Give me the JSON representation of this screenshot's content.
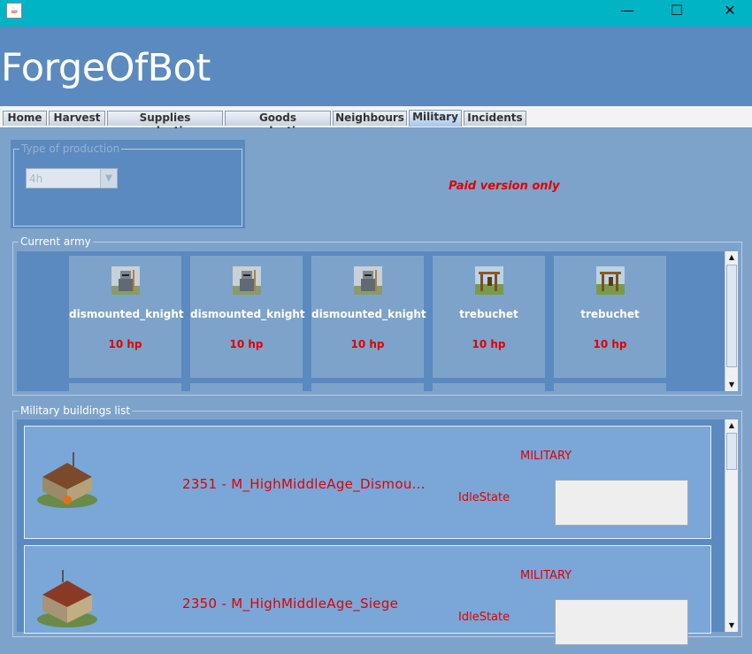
{
  "window": {
    "controls": {
      "minimize": "—",
      "maximize": "☐",
      "close": "✕"
    }
  },
  "app": {
    "brand": "ForgeOfBot"
  },
  "tabs": [
    {
      "label": "Home"
    },
    {
      "label": "Harvest"
    },
    {
      "label": "Supplies production"
    },
    {
      "label": "Goods production"
    },
    {
      "label": "Neighbours"
    },
    {
      "label": "Military",
      "active": true
    },
    {
      "label": "Incidents"
    }
  ],
  "production": {
    "group_title": "Type of production",
    "selected": "4h",
    "enabled": false,
    "notice": "Paid version only"
  },
  "army": {
    "group_title": "Current army",
    "units": [
      {
        "name": "dismounted_knight",
        "hp": "10 hp",
        "icon": "knight-icon"
      },
      {
        "name": "dismounted_knight",
        "hp": "10 hp",
        "icon": "knight-icon"
      },
      {
        "name": "dismounted_knight",
        "hp": "10 hp",
        "icon": "knight-icon"
      },
      {
        "name": "trebuchet",
        "hp": "10 hp",
        "icon": "trebuchet-icon"
      },
      {
        "name": "trebuchet",
        "hp": "10 hp",
        "icon": "trebuchet-icon"
      }
    ]
  },
  "buildings": {
    "group_title": "Military buildings list",
    "items": [
      {
        "name": "2351 - M_HighMiddleAge_Dismou...",
        "type": "MILITARY",
        "state": "IdleState"
      },
      {
        "name": "2350 - M_HighMiddleAge_Siege",
        "type": "MILITARY",
        "state": "IdleState"
      }
    ]
  },
  "colors": {
    "titlebar": "#00b4c5",
    "header": "#5b8ac0",
    "accent_red": "#e00000"
  }
}
